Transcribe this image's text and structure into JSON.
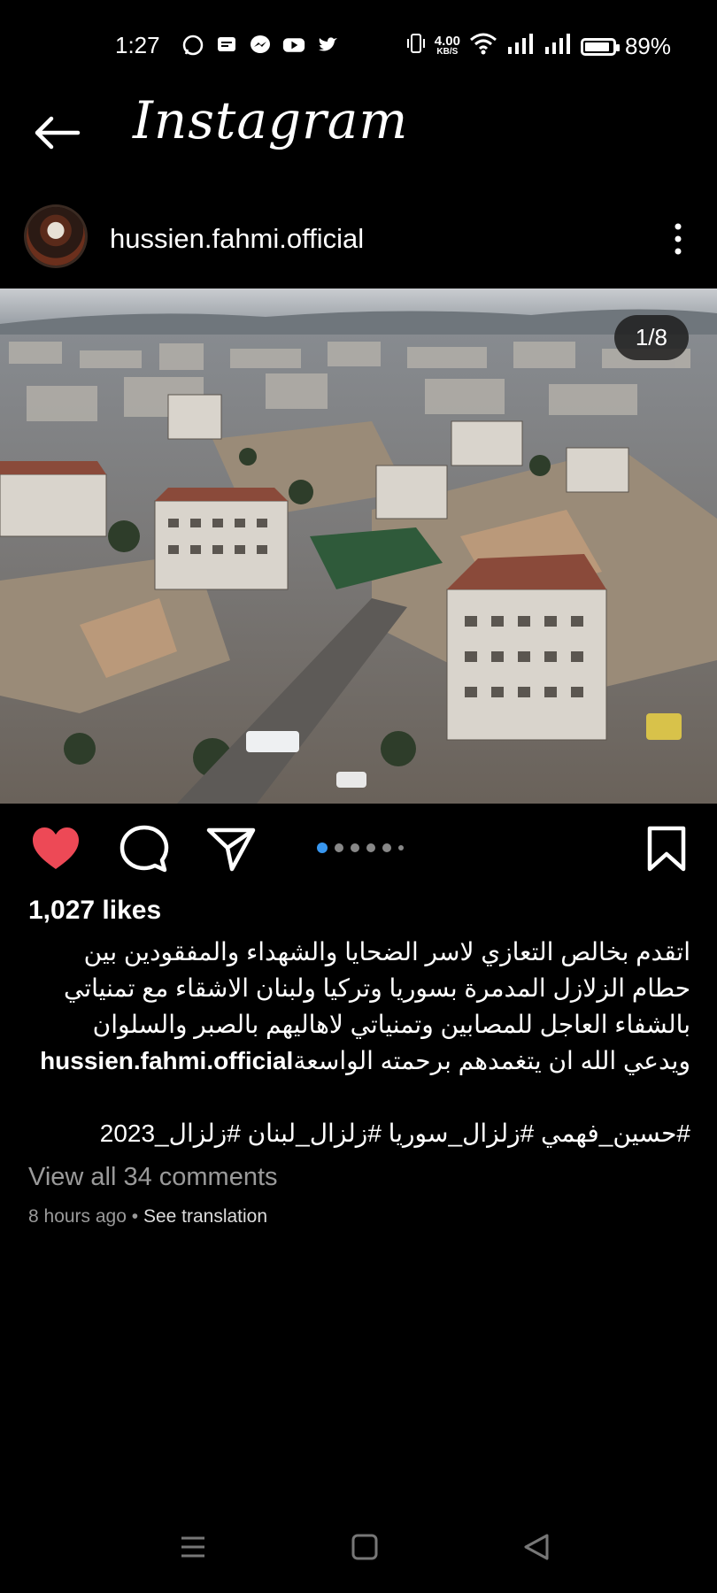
{
  "status": {
    "time": "1:27",
    "speed_value": "4.00",
    "speed_unit": "KB/S",
    "battery": "89%",
    "battery_level": 0.89
  },
  "header": {
    "brand": "Instagram"
  },
  "post": {
    "username": "hussien.fahmi.official",
    "image_counter": "1/8",
    "likes": "1,027 likes",
    "caption_user": "hussien.fahmi.official",
    "caption_text": " اتقدم بخالص التعازي لاسر الضحايا والشهداء والمفقودين بين حطام الزلازل المدمرة بسوريا وتركيا ولبنان الاشقاء مع تمنياتي بالشفاء العاجل للمصابين وتمنياتي لاهاليهم بالصبر والسلوان ويدعي الله ان يتغمدهم برحمته الواسعة",
    "hashtags": "#حسين_فهمي #زلزال_سوريا #زلزال_لبنان #زلزال_2023",
    "view_comments": "View all 34 comments",
    "time_ago": "8 hours ago",
    "see_translation": "See translation"
  },
  "colors": {
    "background": "#000000",
    "like_red": "#ed4956",
    "dot_active": "#3897f0",
    "muted_text": "#9a9a9a"
  }
}
